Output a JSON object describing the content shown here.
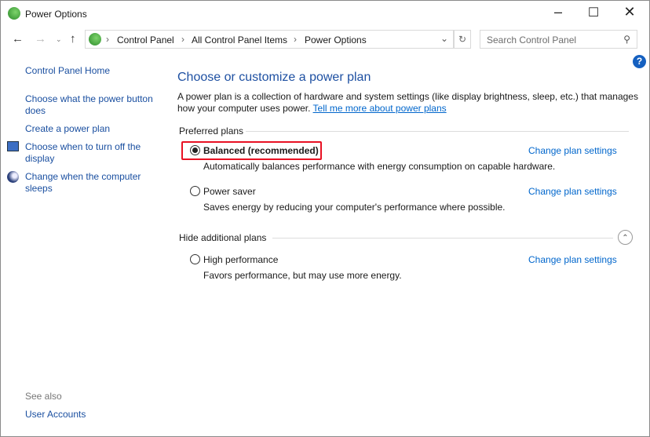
{
  "window": {
    "title": "Power Options"
  },
  "nav": {
    "breadcrumb": [
      "Control Panel",
      "All Control Panel Items",
      "Power Options"
    ],
    "search_placeholder": "Search Control Panel"
  },
  "sidebar": {
    "home": "Control Panel Home",
    "items": [
      {
        "label1": "Choose what the power button",
        "label2": "does"
      },
      {
        "label1": "Create a power plan"
      },
      {
        "label1": "Choose when to turn off the",
        "label2": "display"
      },
      {
        "label1": "Change when the computer",
        "label2": "sleeps"
      }
    ],
    "see_also": "See also",
    "see_also_items": [
      "User Accounts"
    ]
  },
  "main": {
    "title": "Choose or customize a power plan",
    "desc1": "A power plan is a collection of hardware and system settings (like display brightness, sleep, etc.) that manages",
    "desc2": "how your computer uses power.",
    "more_link": "Tell me more about power plans",
    "preferred_label": "Preferred plans",
    "hide_label": "Hide additional plans",
    "change_label": "Change plan settings",
    "plans": [
      {
        "name": "Balanced (recommended)",
        "desc": "Automatically balances performance with energy consumption on capable hardware.",
        "selected": true
      },
      {
        "name": "Power saver",
        "desc": "Saves energy by reducing your computer's performance where possible.",
        "selected": false
      },
      {
        "name": "High performance",
        "desc": "Favors performance, but may use more energy.",
        "selected": false
      }
    ]
  },
  "colors": {
    "highlight": "#e81123",
    "heading": "#1e50a2",
    "link": "#0066cc"
  }
}
